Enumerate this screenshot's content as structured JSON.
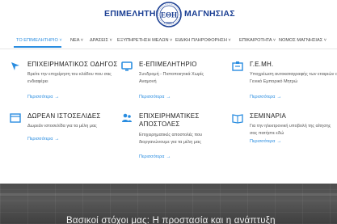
{
  "header": {
    "logo_left": "ΕΠΙΜΕΛΗΤΗΡΙΟ",
    "logo_right": "ΜΑΓΝΗΣΙΑΣ",
    "seal_letters": "ΕΘΗ"
  },
  "nav": {
    "items": [
      {
        "label": "ΤΟ ΕΠΙΜΕΛΗΤΗΡΙΟ ˅"
      },
      {
        "label": "ΝΕΑ ˅"
      },
      {
        "label": "ΔΡΑΣΕΙΣ ˅"
      },
      {
        "label": "ΕΞΥΠΗΡΕΤΗΣΗ ΜΕΛΩΝ ˅"
      },
      {
        "label": "ΕΙΔΙΚΗ ΠΛΗΡΟΦΟΡΗΣΗ ˅"
      },
      {
        "label": "ΕΠΙΚΑΙΡΟΤΗΤΑ ˅"
      },
      {
        "label": "ΝΟΜΟΣ ΜΑΓΝΗΣΙΑΣ ˅"
      }
    ]
  },
  "features": [
    {
      "icon": "compass-icon",
      "title": "ΕΠΙΧΕΙΡΗΜΑΤΙΚΟΣ ΟΔΗΓΟΣ",
      "desc": "Βρείτε την επιχείρηση του κλάδου που σας ενδιαφέρει",
      "more": "Περισσότερα"
    },
    {
      "icon": "monitor-icon",
      "title": "Ε-ΕΠΙΜΕΛΗΤΗΡΙΟ",
      "desc": "Συνδρομή - Πιστοποιητικά Χωρίς Αναμονή",
      "more": "Περισσότερα"
    },
    {
      "icon": "registry-icon",
      "title": "Γ.Ε.ΜΗ.",
      "desc": "Υποχρέωση αυτοκαταγραφής των εταιριών στο Γενικό Εμπορικό Μητρώ",
      "more": "Περισσότερα"
    },
    {
      "icon": "browser-icon",
      "title": "ΔΩΡΕΑΝ ΙΣΤΟΣΕΛΙΔΕΣ",
      "desc": "Δωρεάν ιστοσελίδα για τα μέλη μας",
      "more": "Περισσότερα"
    },
    {
      "icon": "people-icon",
      "title_line1": "ΕΠΙΧΕΙΡΗΜΑΤΙΚΕΣ",
      "title_line2": "ΑΠΟΣΤΟΛΕΣ",
      "desc": "Επιχειρηματικές αποστολές που διοργανώνουμε για τα μέλη μας",
      "more": "Περισσότερα"
    },
    {
      "icon": "book-icon",
      "title": "ΣΕΜΙΝΑΡΙΑ",
      "desc": "Για την ηλεκτρονική υποβολή της αίτησης σας πατήστε εδώ",
      "more": "Περισσότερα"
    }
  ],
  "hero": {
    "title": "Βασικοί στόχοι μας: Η προστασία και η ανάπτυξη"
  },
  "colors": {
    "brand": "#1b3f93",
    "accent": "#2a8de0"
  }
}
